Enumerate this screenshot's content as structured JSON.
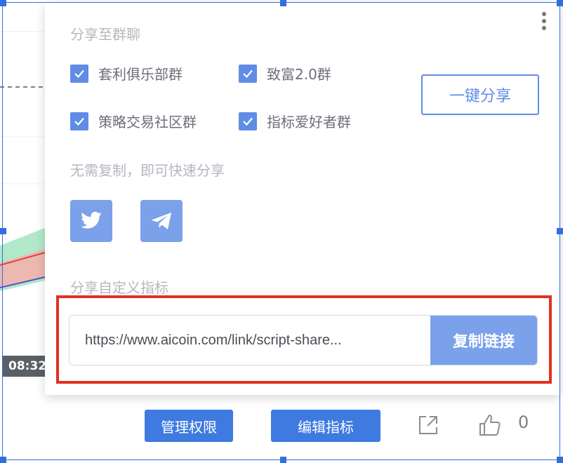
{
  "share_popup": {
    "group_section_title": "分享至群聊",
    "groups": [
      {
        "label": "套利俱乐部群",
        "checked": true
      },
      {
        "label": "致富2.0群",
        "checked": true
      },
      {
        "label": "策略交易社区群",
        "checked": true
      },
      {
        "label": "指标爱好者群",
        "checked": true
      }
    ],
    "one_click_share_label": "一键分享",
    "quick_share_title": "无需复制，即可快速分享",
    "social_icons": [
      "twitter-icon",
      "telegram-icon"
    ],
    "custom_indicator_title": "分享自定义指标",
    "link_value": "https://www.aicoin.com/link/script-share...",
    "copy_link_label": "复制链接"
  },
  "background": {
    "time_label": "08:32"
  },
  "bottom_bar": {
    "manage_permissions_label": "管理权限",
    "edit_indicator_label": "编辑指标",
    "like_count": "0"
  },
  "colors": {
    "accent": "#3f7ae0",
    "checkbox": "#5f8de6",
    "highlight_border": "#e23124"
  }
}
